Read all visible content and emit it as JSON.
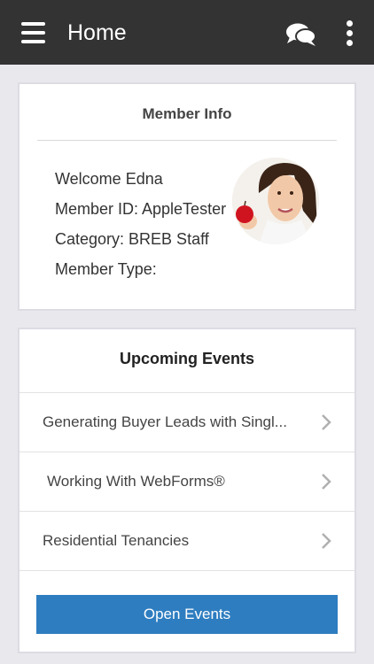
{
  "header": {
    "title": "Home",
    "menu_icon": "hamburger-menu-icon",
    "chat_icon": "chat-bubbles-icon",
    "more_icon": "vertical-dots-icon"
  },
  "member_info": {
    "title": "Member Info",
    "welcome": "Welcome Edna",
    "member_id": "Member ID: AppleTester",
    "category": "Category: BREB Staff",
    "member_type": "Member Type:"
  },
  "events": {
    "title": "Upcoming Events",
    "items": [
      {
        "label": "Generating Buyer Leads with Singl..."
      },
      {
        "label": "Working With WebForms®"
      },
      {
        "label": "Residential Tenancies"
      }
    ],
    "open_button": "Open Events"
  },
  "colors": {
    "topbar": "#333333",
    "accent": "#2e7dc0",
    "background": "#e8e8ed"
  }
}
